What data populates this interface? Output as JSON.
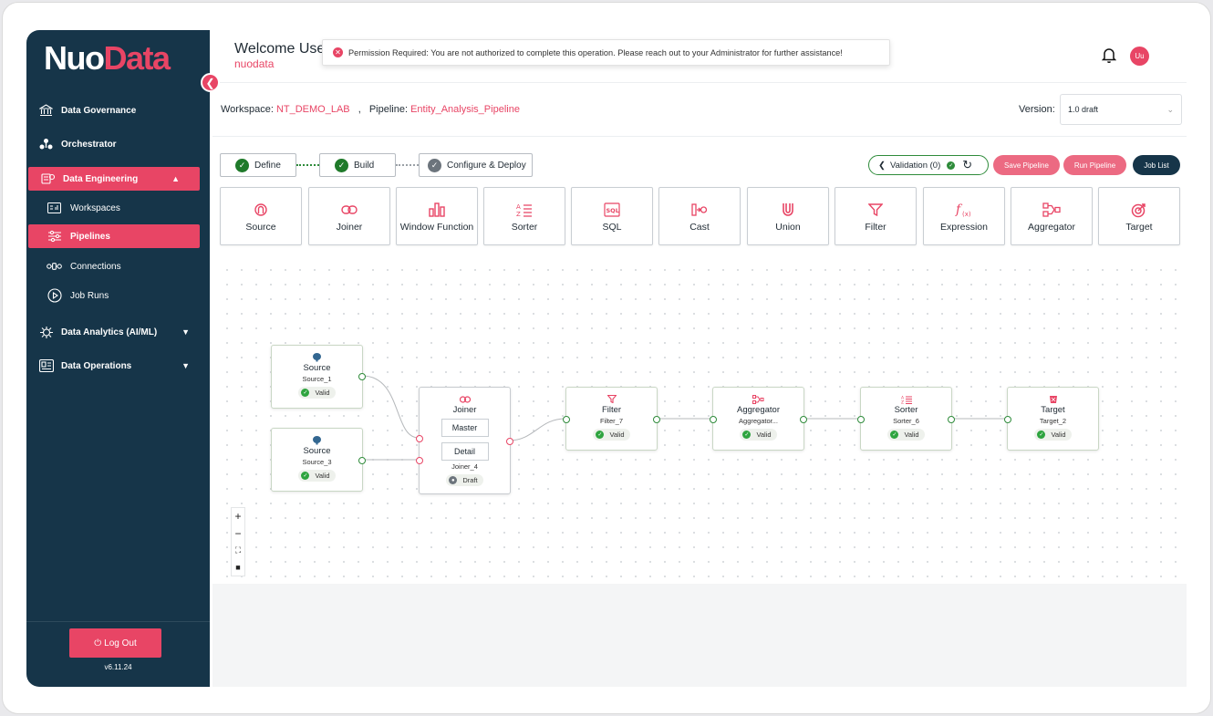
{
  "brand": {
    "part1": "Nuo",
    "part2": "Data"
  },
  "sidebar": {
    "items": [
      {
        "label": "Data Governance",
        "icon": "bank-icon"
      },
      {
        "label": "Orchestrator",
        "icon": "orchestrator-icon"
      },
      {
        "label": "Data Engineering",
        "icon": "engineering-icon"
      },
      {
        "label": "Data Analytics (AI/ML)",
        "icon": "analytics-icon"
      },
      {
        "label": "Data Operations",
        "icon": "operations-icon"
      }
    ],
    "subitems": [
      {
        "label": "Workspaces",
        "icon": "workspace-icon"
      },
      {
        "label": "Pipelines",
        "icon": "pipeline-icon"
      },
      {
        "label": "Connections",
        "icon": "connections-icon"
      },
      {
        "label": "Job Runs",
        "icon": "play-icon"
      }
    ],
    "logout": "Log Out",
    "version": "v6.11.24"
  },
  "header": {
    "welcome": "Welcome Use",
    "org": "nuodata",
    "avatar": "Uu",
    "toast": "Permission Required: You are not authorized to complete this operation. Please reach out to your Administrator for further assistance!"
  },
  "workspace": {
    "ws_label": "Workspace:",
    "ws_value": "NT_DEMO_LAB",
    "sep": ",",
    "pl_label": "Pipeline:",
    "pl_value": "Entity_Analysis_Pipeline",
    "version_label": "Version:",
    "version_value": "1.0 draft"
  },
  "steps": [
    {
      "label": "Define"
    },
    {
      "label": "Build"
    },
    {
      "label": "Configure & Deploy"
    }
  ],
  "actions": {
    "validation": "Validation (0)",
    "save": "Save Pipeline",
    "run": "Run Pipeline",
    "jobs": "Job List"
  },
  "palette": [
    {
      "label": "Source",
      "icon": "source-icon"
    },
    {
      "label": "Joiner",
      "icon": "joiner-icon"
    },
    {
      "label": "Window Function",
      "icon": "window-function-icon"
    },
    {
      "label": "Sorter",
      "icon": "sorter-icon"
    },
    {
      "label": "SQL",
      "icon": "sql-icon"
    },
    {
      "label": "Cast",
      "icon": "cast-icon"
    },
    {
      "label": "Union",
      "icon": "union-icon"
    },
    {
      "label": "Filter",
      "icon": "filter-icon"
    },
    {
      "label": "Expression",
      "icon": "expression-icon"
    },
    {
      "label": "Aggregator",
      "icon": "aggregator-icon"
    },
    {
      "label": "Target",
      "icon": "target-icon"
    }
  ],
  "nodes": {
    "source1": {
      "type": "Source",
      "name": "Source_1",
      "status": "Valid"
    },
    "source3": {
      "type": "Source",
      "name": "Source_3",
      "status": "Valid"
    },
    "joiner": {
      "type": "Joiner",
      "master": "Master",
      "detail": "Detail",
      "name": "Joiner_4",
      "status": "Draft"
    },
    "filter": {
      "type": "Filter",
      "name": "Filter_7",
      "status": "Valid"
    },
    "aggregator": {
      "type": "Aggregator",
      "name": "Aggregator...",
      "status": "Valid"
    },
    "sorter": {
      "type": "Sorter",
      "name": "Sorter_6",
      "status": "Valid"
    },
    "target": {
      "type": "Target",
      "name": "Target_2",
      "status": "Valid"
    }
  },
  "colors": {
    "brand": "#e84565",
    "sidebar": "#163549",
    "valid": "#2ea43f"
  }
}
